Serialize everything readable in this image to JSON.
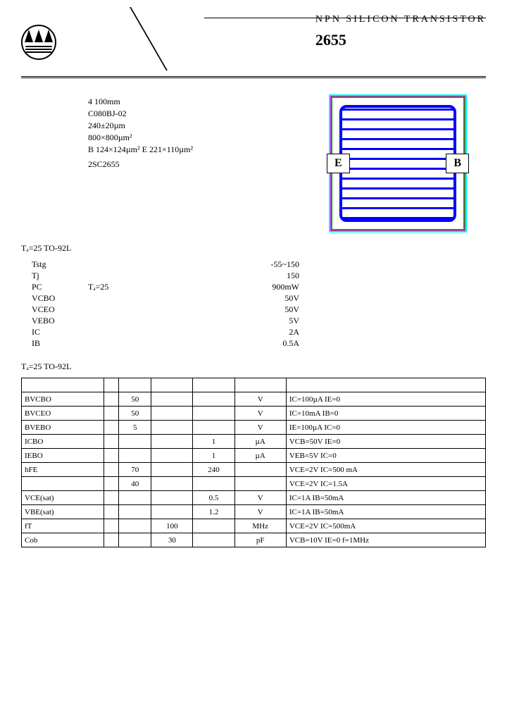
{
  "header": {
    "category": "NPN  SILICON  TRANSISTOR",
    "part": "2655",
    "logo_text": ""
  },
  "section_spec_head": "",
  "section_die_head": "",
  "specs": {
    "wafer": "4        100mm",
    "mask": "C080BJ-02",
    "thickness": "240±20µm",
    "die_size": "800×800µm²",
    "pad": "B  124×124µm²   E  221×110µm²",
    "metal": "",
    "passivation": "",
    "equiv": "2SC2655"
  },
  "die_labels": {
    "e": "E",
    "b": "B"
  },
  "ratings_head": "    Tₐ=25     TO-92L",
  "ratings": [
    {
      "param": "Tstg",
      "desc": "",
      "mid": "",
      "val": "-55~150"
    },
    {
      "param": "Tj",
      "desc": "",
      "mid": "",
      "val": "150"
    },
    {
      "param": "PC",
      "desc": "",
      "mid": "Tₐ=25",
      "val": "900mW"
    },
    {
      "param": "VCBO",
      "desc": "",
      "mid": "",
      "val": "50V"
    },
    {
      "param": "VCEO",
      "desc": "",
      "mid": "",
      "val": "50V"
    },
    {
      "param": "VEBO",
      "desc": "",
      "mid": "",
      "val": "5V"
    },
    {
      "param": "IC",
      "desc": "",
      "mid": "",
      "val": "2A"
    },
    {
      "param": "IB",
      "desc": "",
      "mid": "",
      "val": "0.5A"
    }
  ],
  "elec_head": "    Tₐ=25     TO-92L",
  "elec_cols": [
    "",
    "",
    "",
    "",
    "",
    "",
    ""
  ],
  "elec_rows": [
    {
      "p": "BVCBO",
      "d": "",
      "min": "50",
      "typ": "",
      "max": "",
      "u": "V",
      "c": "IC=100µA  IE=0"
    },
    {
      "p": "BVCEO",
      "d": "",
      "min": "50",
      "typ": "",
      "max": "",
      "u": "V",
      "c": "IC=10mA  IB=0"
    },
    {
      "p": "BVEBO",
      "d": "",
      "min": "5",
      "typ": "",
      "max": "",
      "u": "V",
      "c": "IE=100µA  IC=0"
    },
    {
      "p": "ICBO",
      "d": "",
      "min": "",
      "typ": "",
      "max": "1",
      "u": "µA",
      "c": "VCB=50V  IE=0"
    },
    {
      "p": "IEBO",
      "d": "",
      "min": "",
      "typ": "",
      "max": "1",
      "u": "µA",
      "c": "VEB=5V  IC=0"
    },
    {
      "p": "hFE",
      "d": "",
      "min": "70",
      "typ": "",
      "max": "240",
      "u": "",
      "c": "VCE=2V  IC=500 mA"
    },
    {
      "p": "",
      "d": "",
      "min": "40",
      "typ": "",
      "max": "",
      "u": "",
      "c": "VCE=2V  IC=1.5A"
    },
    {
      "p": "VCE(sat)",
      "d": "",
      "min": "",
      "typ": "",
      "max": "0.5",
      "u": "V",
      "c": "IC=1A  IB=50mA"
    },
    {
      "p": "VBE(sat)",
      "d": "",
      "min": "",
      "typ": "",
      "max": "1.2",
      "u": "V",
      "c": "IC=1A  IB=50mA"
    },
    {
      "p": "fT",
      "d": "",
      "min": "",
      "typ": "100",
      "max": "",
      "u": "MHz",
      "c": "VCE=2V  IC=500mA"
    },
    {
      "p": "Cob",
      "d": "",
      "min": "",
      "typ": "30",
      "max": "",
      "u": "pF",
      "c": "VCB=10V IE=0 f=1MHz"
    }
  ]
}
